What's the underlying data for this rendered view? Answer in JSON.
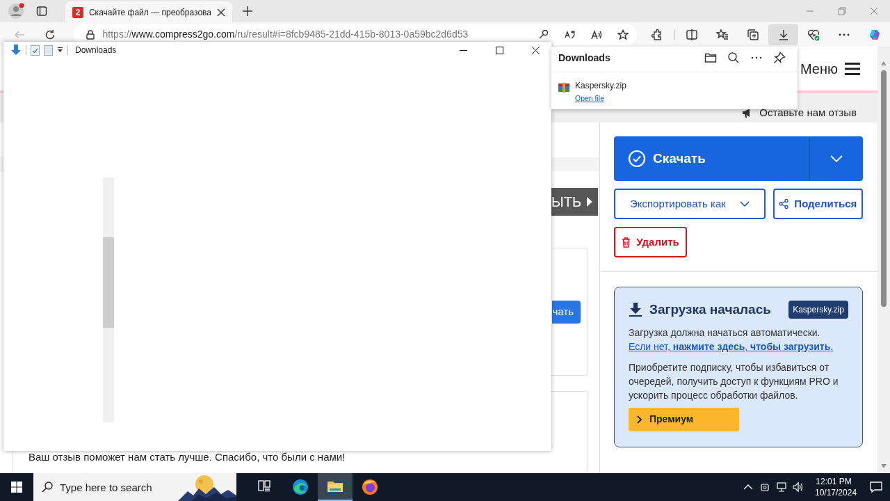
{
  "browser": {
    "tab": {
      "favicon": "2",
      "title": "Скачайте файл — преобразова"
    },
    "address": {
      "scheme": "https://",
      "host": "www.compress2go.com",
      "path": "/ru/result#i=8fcb9485-21dd-415b-8013-0a59bc2d6d53"
    },
    "toolbar": [
      {
        "kind": "extensions",
        "selected": false
      },
      {
        "kind": "split",
        "selected": false
      },
      {
        "kind": "favorites",
        "selected": false
      },
      {
        "kind": "collections",
        "selected": false
      },
      {
        "kind": "downloads",
        "selected": true
      },
      {
        "kind": "health",
        "selected": false
      },
      {
        "kind": "more",
        "selected": false
      },
      {
        "kind": "copilot",
        "selected": false
      }
    ]
  },
  "downloads_panel": {
    "title": "Downloads",
    "items": [
      {
        "file": "Kaspersky.zip",
        "action": "Open file"
      }
    ]
  },
  "file_window": {
    "title": "Downloads"
  },
  "page": {
    "menu": "Меню",
    "feedback_link": "Оставьте нам отзыв",
    "side_button": "ЫТЬ",
    "card_button": "чать",
    "feedback_note": "Ваш отзыв поможет нам стать лучше. Спасибо, что были с нами!",
    "download_button": "Скачать",
    "export_button": "Экспортировать как",
    "share_button": "Поделиться",
    "delete_button": "Удалить",
    "notice": {
      "title": "Загрузка началась",
      "badge": "Kaspersky.zip",
      "auto_text": "Загрузка должна начаться автоматически.",
      "fallback": "Если нет, **нажмите здесь**, **чтобы загрузить**.",
      "pitch": "Приобретите подписку, чтобы избавиться от очередей, получить доступ к функциям PRO и ускорить процесс обработки файлов.",
      "premium_button": "Премиум"
    }
  },
  "taskbar": {
    "search_placeholder": "Type here to search",
    "apps": [
      {
        "kind": "task_view",
        "selected": false
      },
      {
        "kind": "edge",
        "selected": false
      },
      {
        "kind": "explorer",
        "selected": true
      },
      {
        "kind": "firefox",
        "selected": false
      }
    ],
    "time": "12:01 PM",
    "date": "10/17/2024"
  }
}
